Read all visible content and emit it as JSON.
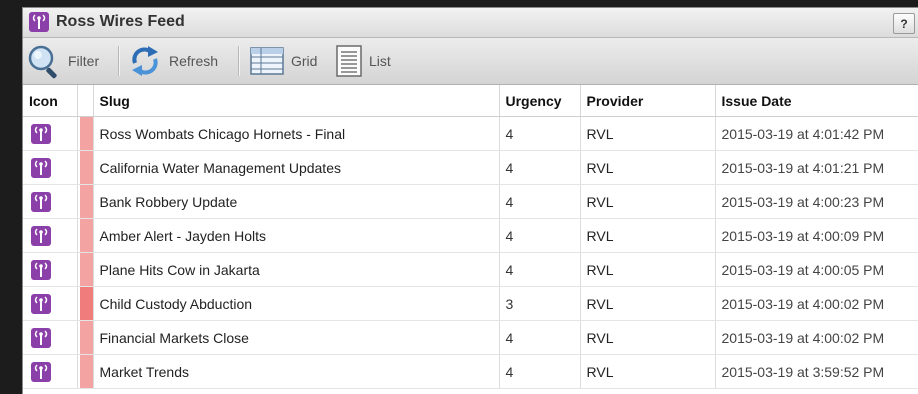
{
  "window": {
    "title": "Ross Wires Feed",
    "help_label": "?"
  },
  "toolbar": {
    "filter_label": "Filter",
    "refresh_label": "Refresh",
    "grid_label": "Grid",
    "list_label": "List"
  },
  "columns": {
    "icon": "Icon",
    "slug": "Slug",
    "urgency": "Urgency",
    "provider": "Provider",
    "issue_date": "Issue Date"
  },
  "colors": {
    "feed_icon": "#8b3fa8",
    "urgency_4": "#f4a3a3",
    "urgency_3": "#f17c7c"
  },
  "rows": [
    {
      "icon": "antenna-icon",
      "slug": "Ross Wombats Chicago Hornets - Final",
      "urgency": "4",
      "provider": "RVL",
      "issue_date": "2015-03-19 at 4:01:42 PM"
    },
    {
      "icon": "antenna-icon",
      "slug": "California Water Management Updates",
      "urgency": "4",
      "provider": "RVL",
      "issue_date": "2015-03-19 at 4:01:21 PM"
    },
    {
      "icon": "antenna-icon",
      "slug": "Bank Robbery Update",
      "urgency": "4",
      "provider": "RVL",
      "issue_date": "2015-03-19 at 4:00:23 PM"
    },
    {
      "icon": "antenna-icon",
      "slug": "Amber Alert - Jayden Holts",
      "urgency": "4",
      "provider": "RVL",
      "issue_date": "2015-03-19 at 4:00:09 PM"
    },
    {
      "icon": "antenna-icon",
      "slug": "Plane Hits Cow in Jakarta",
      "urgency": "4",
      "provider": "RVL",
      "issue_date": "2015-03-19 at 4:00:05 PM"
    },
    {
      "icon": "antenna-icon",
      "slug": "Child Custody Abduction",
      "urgency": "3",
      "provider": "RVL",
      "issue_date": "2015-03-19 at 4:00:02 PM"
    },
    {
      "icon": "antenna-icon",
      "slug": "Financial Markets Close",
      "urgency": "4",
      "provider": "RVL",
      "issue_date": "2015-03-19 at 4:00:02 PM"
    },
    {
      "icon": "antenna-icon",
      "slug": "Market Trends",
      "urgency": "4",
      "provider": "RVL",
      "issue_date": "2015-03-19 at 3:59:52 PM"
    }
  ]
}
